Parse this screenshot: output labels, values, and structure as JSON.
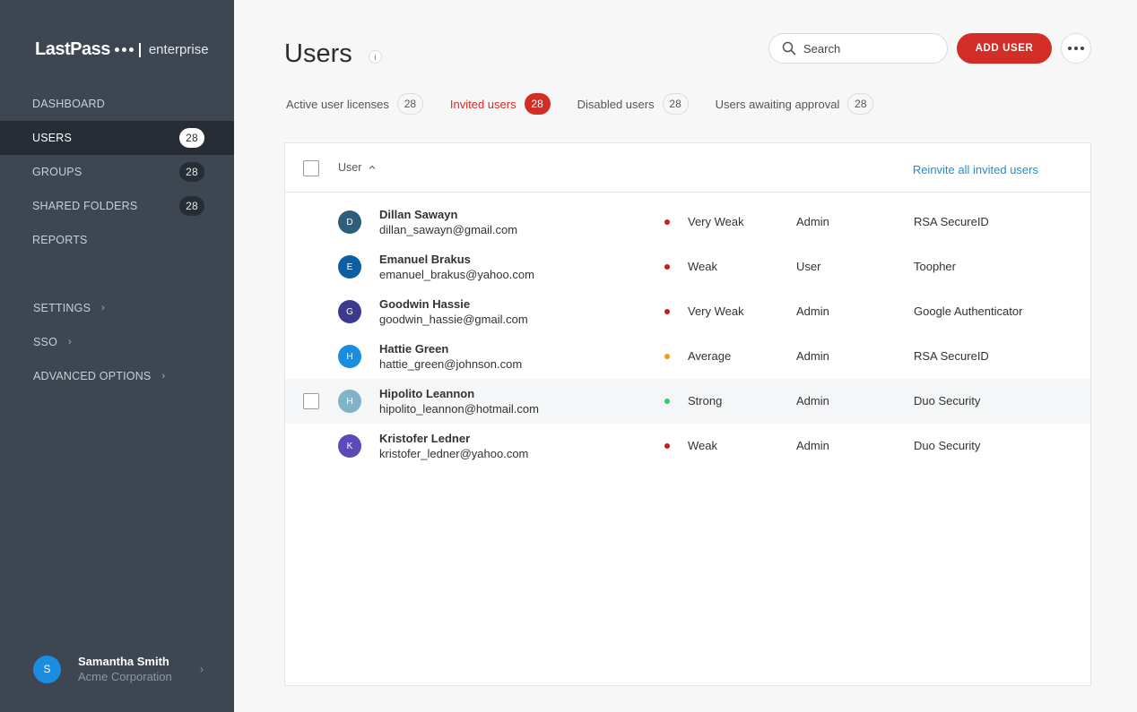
{
  "brand": {
    "name": "LastPass",
    "suffix": "enterprise"
  },
  "sidebar": {
    "nav": [
      {
        "label": "DASHBOARD",
        "count": null,
        "active": false,
        "key": "dashboard"
      },
      {
        "label": "USERS",
        "count": "28",
        "active": true,
        "key": "users"
      },
      {
        "label": "GROUPS",
        "count": "28",
        "active": false,
        "key": "groups"
      },
      {
        "label": "SHARED FOLDERS",
        "count": "28",
        "active": false,
        "key": "shared-folders"
      },
      {
        "label": "REPORTS",
        "count": null,
        "active": false,
        "key": "reports"
      }
    ],
    "nav2": [
      {
        "label": "SETTINGS",
        "key": "settings"
      },
      {
        "label": "SSO",
        "key": "sso"
      },
      {
        "label": "ADVANCED OPTIONS",
        "key": "advanced-options"
      }
    ],
    "profile": {
      "initial": "S",
      "name": "Samantha Smith",
      "org": "Acme Corporation"
    }
  },
  "header": {
    "title": "Users",
    "info": "i",
    "search_placeholder": "Search",
    "add_user": "ADD USER"
  },
  "tabs": [
    {
      "label": "Active user licenses",
      "count": "28",
      "active": false,
      "key": "active-licenses"
    },
    {
      "label": "Invited users",
      "count": "28",
      "active": true,
      "key": "invited-users"
    },
    {
      "label": "Disabled users",
      "count": "28",
      "active": false,
      "key": "disabled-users"
    },
    {
      "label": "Users awaiting approval",
      "count": "28",
      "active": false,
      "key": "awaiting-approval"
    }
  ],
  "table": {
    "column_user": "User",
    "reinvite_all": "Reinvite all invited users",
    "rows": [
      {
        "initial": "D",
        "avatar_color": "#2d5f7a",
        "name": "Dillan Sawayn",
        "email": "dillan_sawayn@gmail.com",
        "strength": "Very Weak",
        "strength_color": "#c0201b",
        "role": "Admin",
        "mfa": "RSA SecureID",
        "hover": false
      },
      {
        "initial": "E",
        "avatar_color": "#0d5fa5",
        "name": "Emanuel Brakus",
        "email": "emanuel_brakus@yahoo.com",
        "strength": "Weak",
        "strength_color": "#c0201b",
        "role": "User",
        "mfa": "Toopher",
        "hover": false
      },
      {
        "initial": "G",
        "avatar_color": "#3b3a8c",
        "name": "Goodwin Hassie",
        "email": "goodwin_hassie@gmail.com",
        "strength": "Very Weak",
        "strength_color": "#c0201b",
        "role": "Admin",
        "mfa": "Google Authenticator",
        "hover": false
      },
      {
        "initial": "H",
        "avatar_color": "#1b8de0",
        "name": "Hattie Green",
        "email": "hattie_green@johnson.com",
        "strength": "Average",
        "strength_color": "#f39c12",
        "role": "Admin",
        "mfa": "RSA SecureID",
        "hover": false
      },
      {
        "initial": "H",
        "avatar_color": "#7fb3c8",
        "name": "Hipolito Leannon",
        "email": "hipolito_leannon@hotmail.com",
        "strength": "Strong",
        "strength_color": "#2ecc71",
        "role": "Admin",
        "mfa": "Duo Security",
        "hover": true
      },
      {
        "initial": "K",
        "avatar_color": "#5a4bb8",
        "name": "Kristofer Ledner",
        "email": "kristofer_ledner@yahoo.com",
        "strength": "Weak",
        "strength_color": "#c0201b",
        "role": "Admin",
        "mfa": "Duo Security",
        "hover": false
      }
    ]
  }
}
